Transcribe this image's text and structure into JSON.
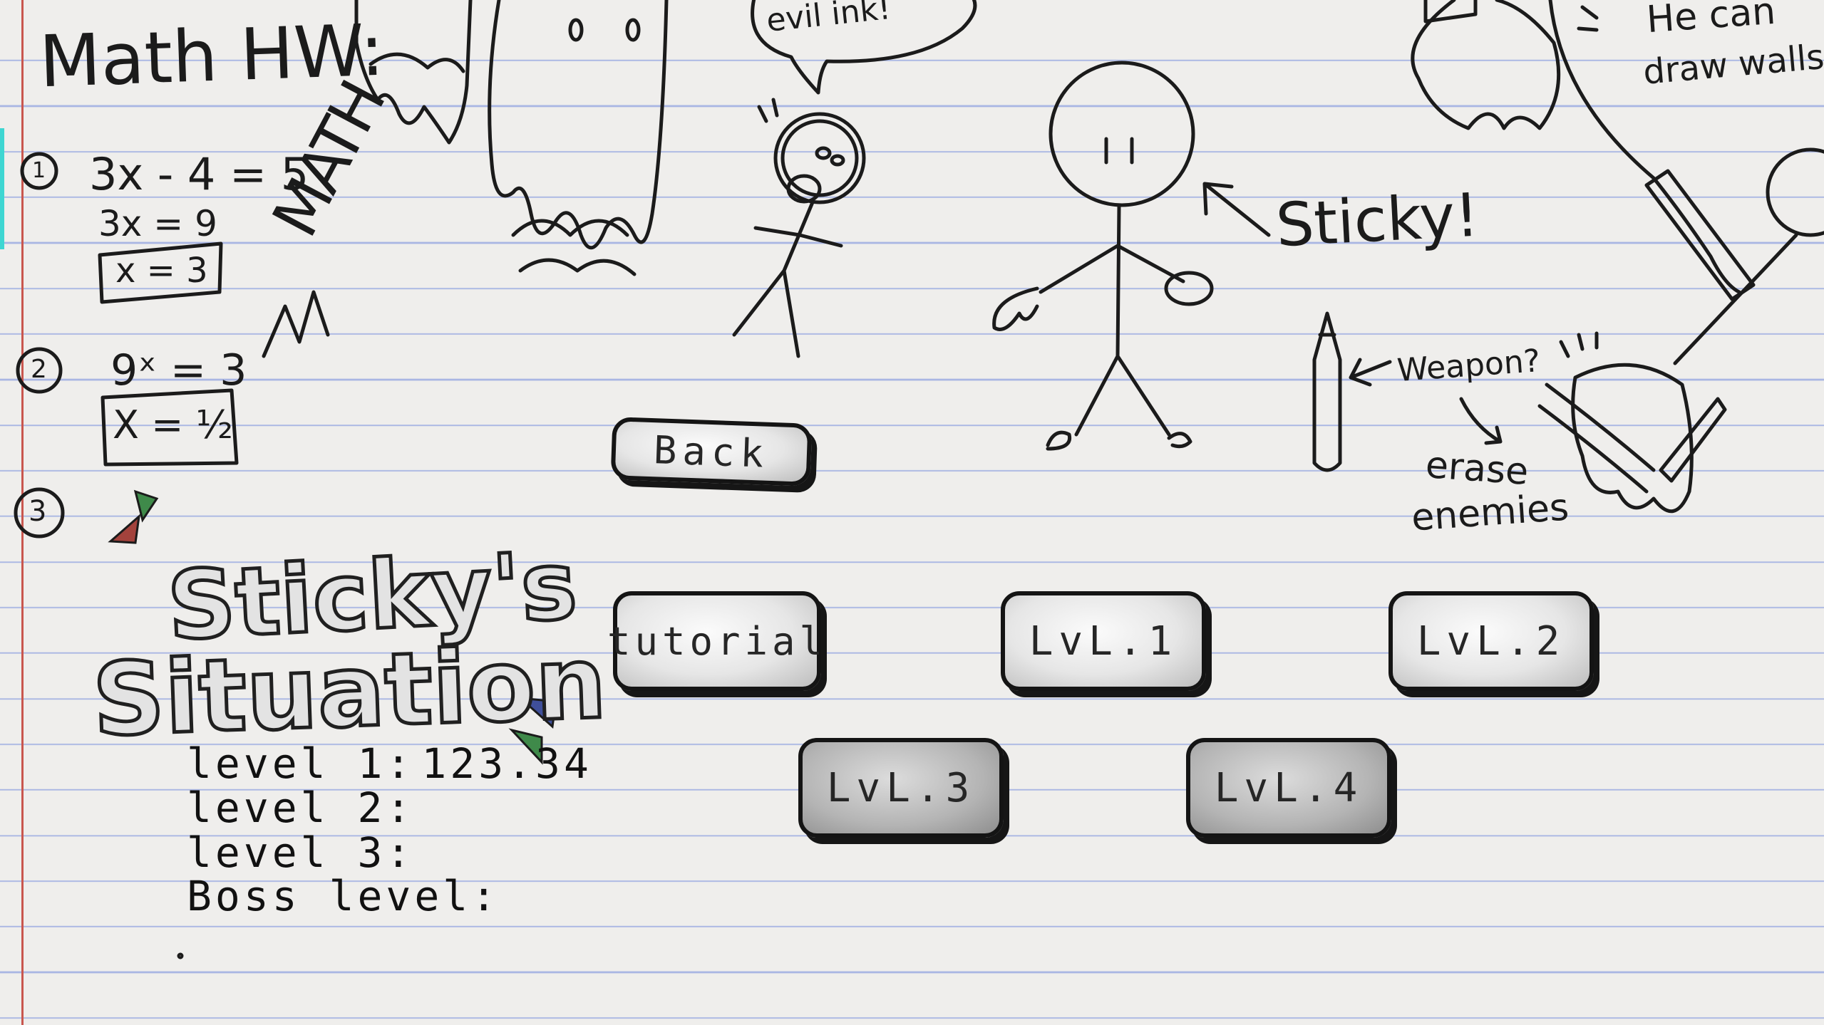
{
  "notes": {
    "title": "Math HW:",
    "problem1": {
      "number": "1",
      "equation": "3x - 4 = 5",
      "step": "3x = 9",
      "answer": "x = 3"
    },
    "scribble": "MATH",
    "problem2": {
      "number": "2",
      "equation": "9ˣ = 3",
      "answer": "X = ½"
    },
    "problem3": {
      "number": "3"
    }
  },
  "doodles": {
    "speech_bubble": "evil ink!",
    "sticky_label": "Sticky!",
    "weapon_label": "Weapon?",
    "erase_label_line1": "erase",
    "erase_label_line2": "enemies",
    "walls_label_line1": "He can",
    "walls_label_line2": "draw walls!"
  },
  "logo": {
    "line1": "Sticky's",
    "line2": "Situation"
  },
  "buttons": {
    "back": "Back",
    "tutorial": "tutorial",
    "level1": "LvL.1",
    "level2": "LvL.2",
    "level3": "LvL.3",
    "level4": "LvL.4"
  },
  "scores": [
    {
      "label": "level 1:",
      "value": "123.34"
    },
    {
      "label": "level 2:",
      "value": ""
    },
    {
      "label": "level 3:",
      "value": ""
    },
    {
      "label": "Boss level:",
      "value": ""
    }
  ],
  "colors": {
    "paper": "#efeeec",
    "rule_line": "#a9b6e3",
    "margin_line": "#c9574f",
    "tab": "#3ed6d2",
    "ink": "#1b1b1b",
    "gem_green": "#3f8a4a",
    "gem_red": "#a3423c",
    "gem_blue": "#3f4f9a"
  }
}
